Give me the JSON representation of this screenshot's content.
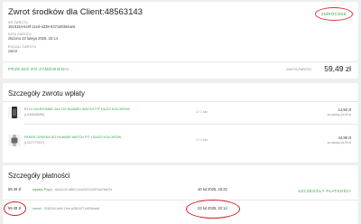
{
  "header": {
    "title": "Zwrot środków dla Client:48563143",
    "status_button": "ZWRÓCONE",
    "fields": [
      {
        "label": "NR ZWROTU",
        "value": "1518154-6c6f-11ed-a338-6371d8364ae6"
      },
      {
        "label": "DATA ZWROTU",
        "value": "złożono 23 lutego 2025, 22:14"
      },
      {
        "label": "RODZAJ ZWROTU",
        "value": "zwrot"
      }
    ],
    "back_link": "PRZEJDŹ DO ZAMÓWIENIA",
    "total_label": "KWOTA ZWROTU",
    "total_value": "59,49 zł"
  },
  "refund_details": {
    "title": "Szczegóły zwrotu wpłaty",
    "items": [
      {
        "name": "ETUI OCHRONNE 2w1 DO HUAWEI WATCH FIT DUŻO KOLORÓW",
        "sku": "[12008068099]",
        "qty": "1 / 1 szt.",
        "price": "14,50 zł",
        "subtotal": "za sztukę 14,50 zł"
      },
      {
        "name": "PASEK OPASKA DO HUAWEI WATCH FIT | DUŻO KOLORÓW",
        "sku": "[13127779137]",
        "qty": "1 / 1 szt.",
        "price": "44,99 zł",
        "subtotal": "za sztukę 44,99 zł"
      }
    ]
  },
  "payments": {
    "title": "Szczegóły płatności",
    "button": "SZCZEGÓŁY PŁATNOŚCI",
    "rows": [
      {
        "amount": "59,49 zł",
        "link": "wpłata Payu",
        "id": "a1b1c1f2-a8b0-11ed-8216-6197da7bbd7a",
        "date": "10 lut 2025, 18:22"
      },
      {
        "amount": "59,49 zł",
        "link": "zwrot",
        "id": "1518154-6c6f-11ed-a338-6371d8364ae6",
        "date": "23 lut 2025, 22:14"
      }
    ]
  }
}
